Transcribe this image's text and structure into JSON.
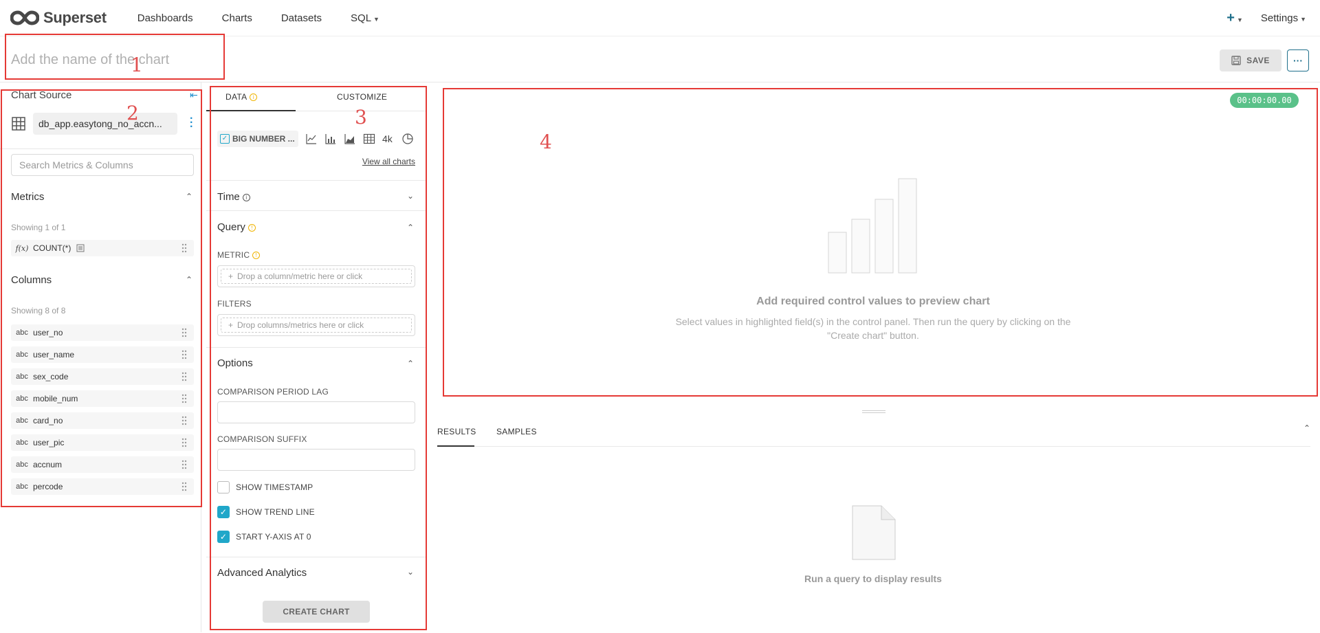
{
  "brand": {
    "name": "Superset"
  },
  "nav": {
    "links": [
      "Dashboards",
      "Charts",
      "Datasets",
      "SQL"
    ],
    "settings": "Settings"
  },
  "header": {
    "chart_name_placeholder": "Add the name of the chart",
    "save_label": "SAVE"
  },
  "annotations": [
    "1",
    "2",
    "3",
    "4"
  ],
  "left": {
    "chart_source": "Chart Source",
    "dataset": "db_app.easytong_no_accn...",
    "search_placeholder": "Search Metrics & Columns",
    "metrics_title": "Metrics",
    "metrics_showing": "Showing 1 of 1",
    "metrics": [
      {
        "type": "f(x)",
        "label": "COUNT(*)"
      }
    ],
    "columns_title": "Columns",
    "columns_showing": "Showing 8 of 8",
    "columns": [
      {
        "type": "abc",
        "label": "user_no"
      },
      {
        "type": "abc",
        "label": "user_name"
      },
      {
        "type": "abc",
        "label": "sex_code"
      },
      {
        "type": "abc",
        "label": "mobile_num"
      },
      {
        "type": "abc",
        "label": "card_no"
      },
      {
        "type": "abc",
        "label": "user_pic"
      },
      {
        "type": "abc",
        "label": "accnum"
      },
      {
        "type": "abc",
        "label": "percode"
      }
    ]
  },
  "mid": {
    "tab_data": "DATA",
    "tab_customize": "CUSTOMIZE",
    "viz_selected": "BIG NUMBER ...",
    "viz_4k": "4k",
    "view_all": "View all charts",
    "time_title": "Time",
    "query_title": "Query",
    "metric_label": "METRIC",
    "metric_drop": "Drop a column/metric here or click",
    "filters_label": "FILTERS",
    "filters_drop": "Drop columns/metrics here or click",
    "options_title": "Options",
    "comparison_lag_label": "COMPARISON PERIOD LAG",
    "comparison_suffix_label": "COMPARISON SUFFIX",
    "show_timestamp": "SHOW TIMESTAMP",
    "show_trend_line": "SHOW TREND LINE",
    "start_y_axis": "START Y-AXIS AT 0",
    "advanced_title": "Advanced Analytics",
    "create_chart": "CREATE CHART"
  },
  "checkboxes": {
    "show_timestamp": false,
    "show_trend_line": true,
    "start_y_axis": true
  },
  "preview": {
    "timer": "00:00:00.00",
    "empty_title": "Add required control values to preview chart",
    "empty_desc": "Select values in highlighted field(s) in the control panel. Then run the query by clicking on the \"Create chart\" button."
  },
  "results": {
    "tab_results": "RESULTS",
    "tab_samples": "SAMPLES",
    "empty": "Run a query to display results"
  },
  "colors": {
    "accent": "#20a7c9",
    "annotation": "#e53935",
    "timer": "#5ac189"
  }
}
